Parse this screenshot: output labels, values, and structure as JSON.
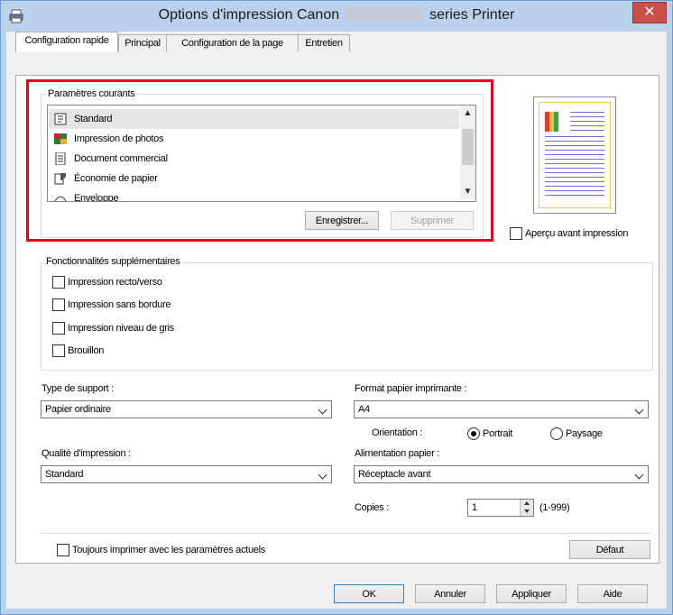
{
  "window": {
    "title_prefix": "Options d'impression Canon",
    "title_suffix": "series Printer",
    "close_glyph": "✕"
  },
  "tabs": [
    {
      "label": "Configuration rapide",
      "active": true
    },
    {
      "label": "Principal",
      "active": false
    },
    {
      "label": "Configuration de la page",
      "active": false
    },
    {
      "label": "Entretien",
      "active": false
    }
  ],
  "current_settings": {
    "group_title": "Paramètres courants",
    "items": [
      {
        "label": "Standard",
        "icon": "standard-doc-icon",
        "selected": true
      },
      {
        "label": "Impression de photos",
        "icon": "photo-print-icon",
        "selected": false
      },
      {
        "label": "Document commercial",
        "icon": "business-doc-icon",
        "selected": false
      },
      {
        "label": "Économie de papier",
        "icon": "paper-saving-icon",
        "selected": false
      },
      {
        "label": "Enveloppe",
        "icon": "envelope-icon",
        "selected": false
      }
    ],
    "save_label": "Enregistrer...",
    "delete_label": "Supprimer"
  },
  "preview": {
    "checkbox_label": "Aperçu avant impression",
    "checked": false
  },
  "extra_features": {
    "group_title": "Fonctionnalités supplémentaires",
    "items": [
      {
        "label": "Impression recto/verso",
        "checked": false
      },
      {
        "label": "Impression sans bordure",
        "checked": false
      },
      {
        "label": "Impression niveau de gris",
        "checked": false
      },
      {
        "label": "Brouillon",
        "checked": false
      }
    ]
  },
  "media_type": {
    "label": "Type de support :",
    "value": "Papier ordinaire"
  },
  "print_quality": {
    "label": "Qualité d'impression :",
    "value": "Standard"
  },
  "paper_size": {
    "label": "Format papier imprimante :",
    "value": "A4"
  },
  "orientation": {
    "label": "Orientation :",
    "portrait": "Portrait",
    "landscape": "Paysage",
    "selected": "Portrait"
  },
  "paper_source": {
    "label": "Alimentation papier :",
    "value": "Réceptacle avant"
  },
  "copies": {
    "label": "Copies :",
    "value": "1",
    "range": "(1-999)"
  },
  "always_print": {
    "label": "Toujours imprimer avec les paramètres actuels",
    "checked": false
  },
  "buttons": {
    "default": "Défaut",
    "ok": "OK",
    "cancel": "Annuler",
    "apply": "Appliquer",
    "help": "Aide"
  }
}
